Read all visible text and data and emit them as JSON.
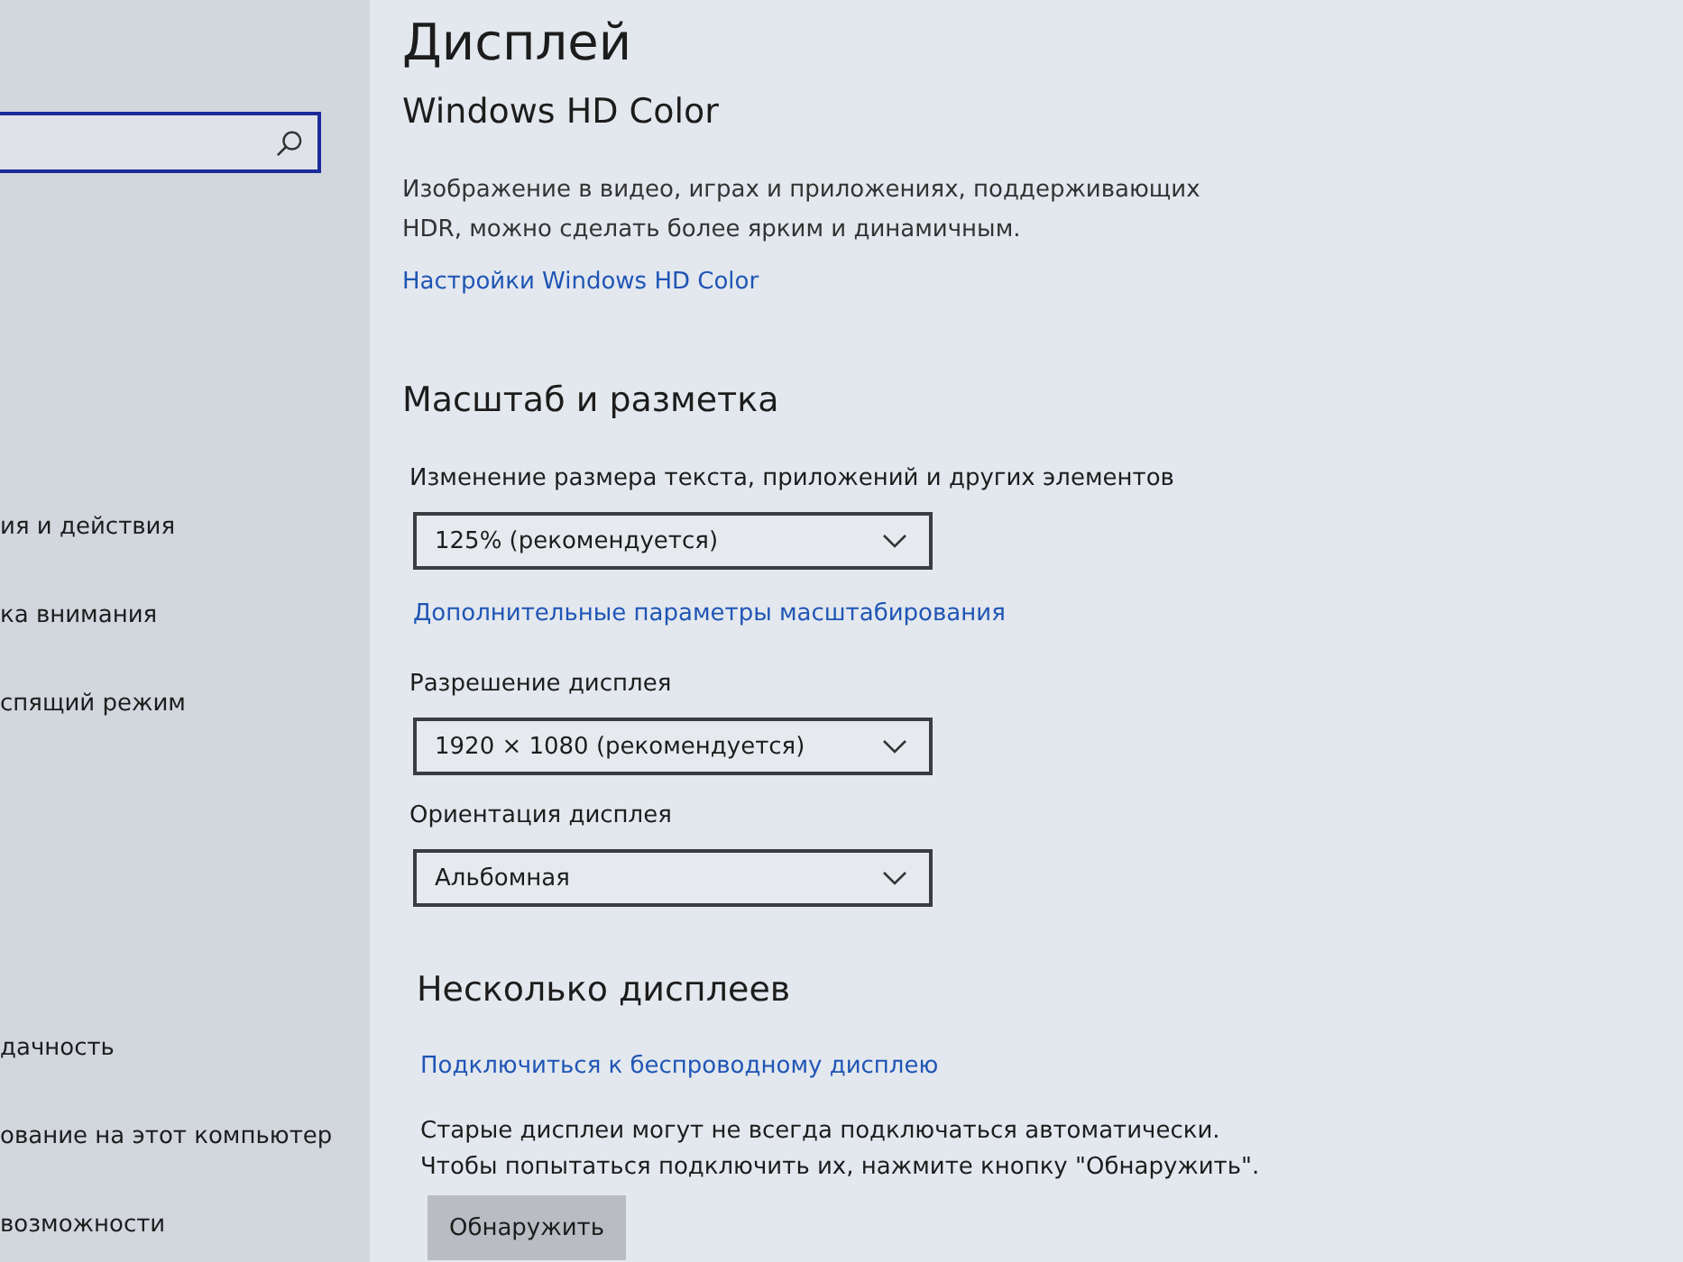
{
  "sidebar": {
    "items": [
      {
        "label": "ия и действия",
        "selected": false
      },
      {
        "label": "ка внимания",
        "selected": false
      },
      {
        "label": "спящий режим",
        "selected": false
      },
      {
        "label": "дачность",
        "selected": false
      },
      {
        "label": "ование на этот компьютер",
        "selected": false
      },
      {
        "label": "возможности",
        "selected": false
      }
    ]
  },
  "page": {
    "title": "Дисплей"
  },
  "hd_color": {
    "heading": "Windows HD Color",
    "description": "Изображение в видео, играх и приложениях, поддерживающих\nHDR, можно сделать более ярким и динамичным.",
    "link": "Настройки Windows HD Color"
  },
  "scale_and_layout": {
    "heading": "Масштаб и разметка",
    "settings": [
      {
        "kind": "dropdown",
        "label": "Изменение размера текста, приложений и других элементов",
        "value": "125% (рекомендуется)"
      },
      {
        "kind": "link",
        "label": "Дополнительные параметры масштабирования"
      },
      {
        "kind": "dropdown",
        "label": "Разрешение дисплея",
        "value": "1920 × 1080 (рекомендуется)"
      },
      {
        "kind": "dropdown",
        "label": "Ориентация дисплея",
        "value": "Альбомная"
      }
    ]
  },
  "multiple_displays": {
    "heading": "Несколько дисплеев",
    "link": "Подключиться к беспроводному дисплею",
    "description": "Старые дисплеи могут не всегда подключаться автоматически.\nЧтобы попытаться подключить их, нажмите кнопку \"Обнаружить\".",
    "button": "Обнаружить"
  }
}
